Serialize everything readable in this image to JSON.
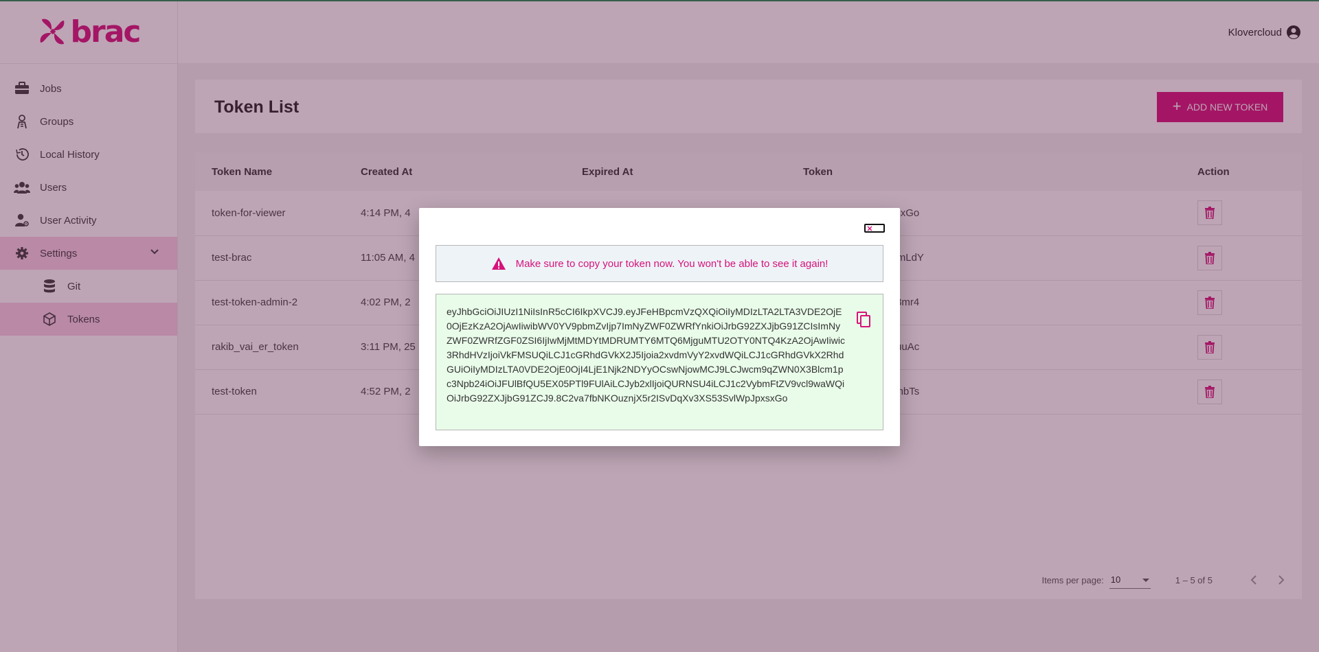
{
  "brand": {
    "name": "brac",
    "accent": "#d6127a"
  },
  "header": {
    "user_name": "Klovercloud"
  },
  "sidebar": {
    "items": [
      {
        "label": "Jobs",
        "icon": "briefcase-icon"
      },
      {
        "label": "Groups",
        "icon": "groups-icon"
      },
      {
        "label": "Local History",
        "icon": "history-icon"
      },
      {
        "label": "Users",
        "icon": "users-icon"
      },
      {
        "label": "User Activity",
        "icon": "user-activity-icon"
      },
      {
        "label": "Settings",
        "icon": "gear-icon"
      },
      {
        "label": "Git",
        "icon": "git-icon"
      },
      {
        "label": "Tokens",
        "icon": "cube-icon"
      }
    ]
  },
  "main": {
    "title": "Token List",
    "add_button_label": "ADD NEW TOKEN",
    "table": {
      "columns": [
        "Token Name",
        "Created At",
        "Expired At",
        "Token",
        "Action"
      ],
      "rows": [
        {
          "name": "token-for-viewer",
          "created": "4:14 PM, 4",
          "token": "********************xsxGo"
        },
        {
          "name": "test-brac",
          "created": "11:05 AM, 4",
          "token": "********************PmLdY"
        },
        {
          "name": "test-token-admin-2",
          "created": "4:02 PM, 2",
          "token": "********************n3mr4"
        },
        {
          "name": "rakib_vai_er_token",
          "created": "3:11 PM, 25",
          "token": "********************4uuAc"
        },
        {
          "name": "test-token",
          "created": "4:52 PM, 2",
          "token": "********************HnbTs"
        }
      ]
    },
    "pagination": {
      "items_per_page_label": "Items per page:",
      "items_per_page": "10",
      "range": "1 – 5 of 5"
    }
  },
  "dialog": {
    "warning": "Make sure to copy your token now. You won't be able to see it again!",
    "token": "eyJhbGciOiJIUzI1NiIsInR5cCI6IkpXVCJ9.eyJFeHBpcmVzQXQiOiIyMDIzLTA2LTA3VDE2OjE0OjEzKzA2OjAwIiwibWV0YV9pbmZvIjp7ImNyZWF0ZWRfYnkiOiJrbG92ZXJjbG91ZCIsImNyZWF0ZWRfZGF0ZSI6IjIwMjMtMDYtMDRUMTY6MTQ6MjguMTU2OTY0NTQ4KzA2OjAwIiwic3RhdHVzIjoiVkFMSUQiLCJ1cGRhdGVkX2J5Ijoia2xvdmVyY2xvdWQiLCJ1cGRhdGVkX2RhdGUiOiIyMDIzLTA0VDE2OjE0OjI4LjE1Njk2NDYyOCswNjowMCJ9LCJwcm9qZWN0X3Blcm1pc3Npb24iOiJFUlBfQU5EX05PTl9FUlAiLCJyb2xlIjoiQURNSU4iLCJ1c2VybmFtZV9vcl9waWQiOiJrbG92ZXJjbG91ZCJ9.8C2va7fbNKOuznjX5r2ISvDqXv3XS53SvlWpJpxsxGo"
  }
}
